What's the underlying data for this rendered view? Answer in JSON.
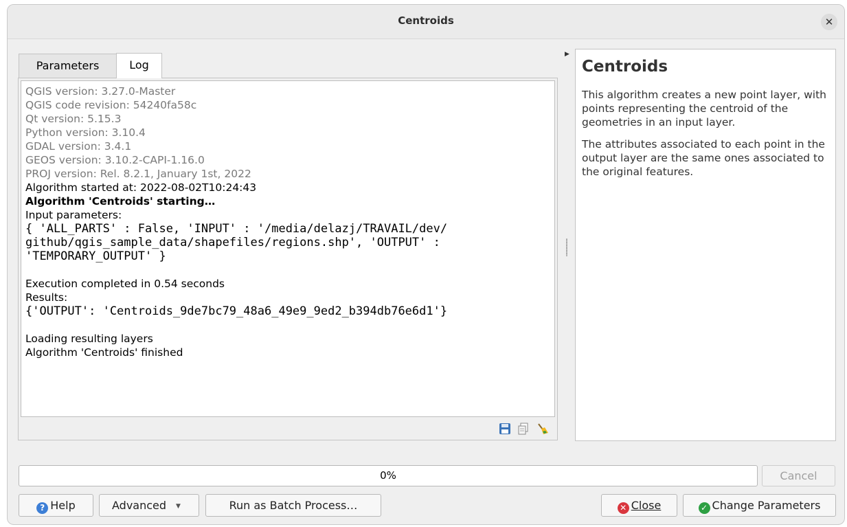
{
  "window": {
    "title": "Centroids"
  },
  "tabs": [
    {
      "label": "Parameters"
    },
    {
      "label": "Log"
    }
  ],
  "log": {
    "lines": [
      {
        "text": "QGIS version: 3.27.0-Master",
        "style": "grey"
      },
      {
        "text": "QGIS code revision: 54240fa58c",
        "style": "grey"
      },
      {
        "text": "Qt version: 5.15.3",
        "style": "grey"
      },
      {
        "text": "Python version: 3.10.4",
        "style": "grey"
      },
      {
        "text": "GDAL version: 3.4.1",
        "style": "grey"
      },
      {
        "text": "GEOS version: 3.10.2-CAPI-1.16.0",
        "style": "grey"
      },
      {
        "text": "PROJ version: Rel. 8.2.1, January 1st, 2022",
        "style": "grey"
      },
      {
        "text": "Algorithm started at: 2022-08-02T10:24:43",
        "style": "normal"
      },
      {
        "text": "Algorithm 'Centroids' starting…",
        "style": "bold"
      },
      {
        "text": "Input parameters:",
        "style": "normal"
      },
      {
        "text": "{ 'ALL_PARTS' : False, 'INPUT' : '/media/delazj/TRAVAIL/dev/",
        "style": "mono"
      },
      {
        "text": "github/qgis_sample_data/shapefiles/regions.shp', 'OUTPUT' :",
        "style": "mono"
      },
      {
        "text": "'TEMPORARY_OUTPUT' }",
        "style": "mono"
      },
      {
        "text": "",
        "style": "blank"
      },
      {
        "text": "Execution completed in 0.54 seconds",
        "style": "normal"
      },
      {
        "text": "Results:",
        "style": "normal"
      },
      {
        "text": "{'OUTPUT': 'Centroids_9de7bc79_48a6_49e9_9ed2_b394db76e6d1'}",
        "style": "mono"
      },
      {
        "text": "",
        "style": "blank"
      },
      {
        "text": "Loading resulting layers",
        "style": "normal"
      },
      {
        "text": "Algorithm 'Centroids' finished",
        "style": "normal"
      }
    ],
    "tools": [
      "save-log-icon",
      "copy-log-icon",
      "clear-log-icon"
    ]
  },
  "help": {
    "title": "Centroids",
    "paragraphs": [
      "This algorithm creates a new point layer, with points representing the centroid of the geometries in an input layer.",
      "The attributes associated to each point in the output layer are the same ones associated to the original features."
    ]
  },
  "progress": {
    "label": "0%",
    "value": 0
  },
  "buttons": {
    "cancel": "Cancel",
    "help": "Help",
    "advanced": "Advanced",
    "batch": "Run as Batch Process…",
    "close": "Close",
    "change_params": "Change Parameters"
  },
  "colors": {
    "help_icon": "#3d7fd6",
    "close_icon": "#d9363e",
    "ok_icon": "#2ea043"
  }
}
